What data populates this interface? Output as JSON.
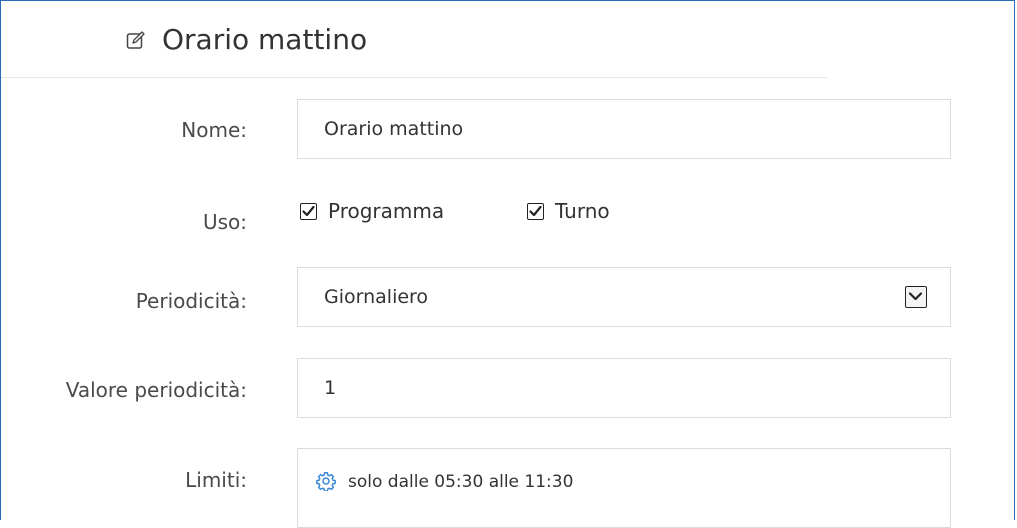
{
  "header": {
    "title": "Orario mattino",
    "icon": "edit-icon"
  },
  "form": {
    "nome": {
      "label": "Nome:",
      "value": "Orario mattino"
    },
    "uso": {
      "label": "Uso:",
      "options": [
        {
          "label": "Programma",
          "checked": true
        },
        {
          "label": "Turno",
          "checked": true
        }
      ]
    },
    "periodicita": {
      "label": "Periodicità:",
      "selected": "Giornaliero"
    },
    "valore_periodicita": {
      "label": "Valore periodicità:",
      "value": "1"
    },
    "limiti": {
      "label": "Limiti:",
      "value": "solo dalle 05:30 alle 11:30",
      "icon": "gear-icon",
      "icon_color": "#3a8ad6"
    }
  },
  "colors": {
    "frame_border": "#2b6cb8",
    "field_border": "#dcdcdc"
  }
}
